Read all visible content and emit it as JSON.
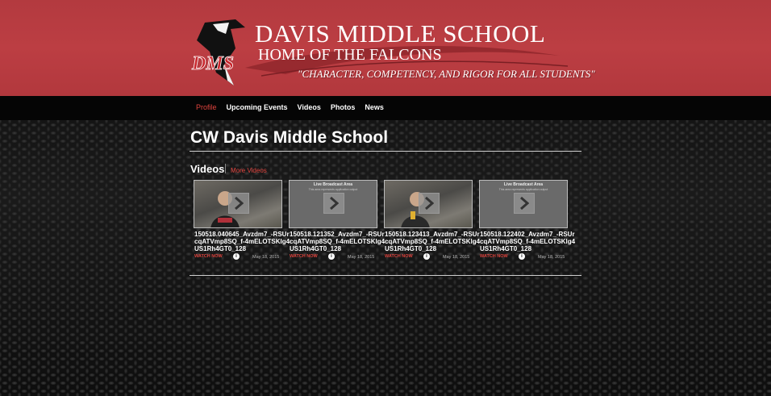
{
  "header": {
    "logo_text": "DMS",
    "school_name": "DAVIS MIDDLE SCHOOL",
    "subtitle": "HOME OF THE FALCONS",
    "motto": "\"CHARACTER, COMPETENCY, AND RIGOR FOR ALL STUDENTS\""
  },
  "nav": {
    "items": [
      {
        "label": "Profile",
        "active": true
      },
      {
        "label": "Upcoming Events",
        "active": false
      },
      {
        "label": "Videos",
        "active": false
      },
      {
        "label": "Photos",
        "active": false
      },
      {
        "label": "News",
        "active": false
      }
    ]
  },
  "main": {
    "title": "CW Davis Middle School",
    "videos_heading": "Videos",
    "more_videos_label": "More Videos",
    "videos": [
      {
        "thumbnail": "photo",
        "title": "150518.040645_Avzdm7_-RSUrcqATVmp8SQ_f-4mELOTSKlg4US1Rh4GT0_128",
        "watch_label": "WATCH NOW",
        "info_icon": "info-icon",
        "date": "May 18, 2015"
      },
      {
        "thumbnail": "slate",
        "slate_title": "Live Broadcast Area",
        "slate_sub": "This area represents application output",
        "title": "150518.121352_Avzdm7_-RSUrcqATVmp8SQ_f-4mELOTSKlg4US1Rh4GT0_128",
        "watch_label": "WATCH NOW",
        "info_icon": "info-icon",
        "date": "May 18, 2015"
      },
      {
        "thumbnail": "photo",
        "title": "150518.123413_Avzdm7_-RSUrcqATVmp8SQ_f-4mELOTSKlg4US1Rh4GT0_128",
        "watch_label": "WATCH NOW",
        "info_icon": "info-icon",
        "date": "May 18, 2015"
      },
      {
        "thumbnail": "slate",
        "slate_title": "Live Broadcast Area",
        "slate_sub": "This area represents application output",
        "title": "150518.122402_Avzdm7_-RSUrcqATVmp8SQ_f-4mELOTSKlg4US1Rh4GT0_128",
        "watch_label": "WATCH NOW",
        "info_icon": "info-icon",
        "date": "May 18, 2015"
      }
    ]
  },
  "colors": {
    "banner": "#bc3e43",
    "accent": "#e0443e",
    "nav_background": "#050505"
  }
}
